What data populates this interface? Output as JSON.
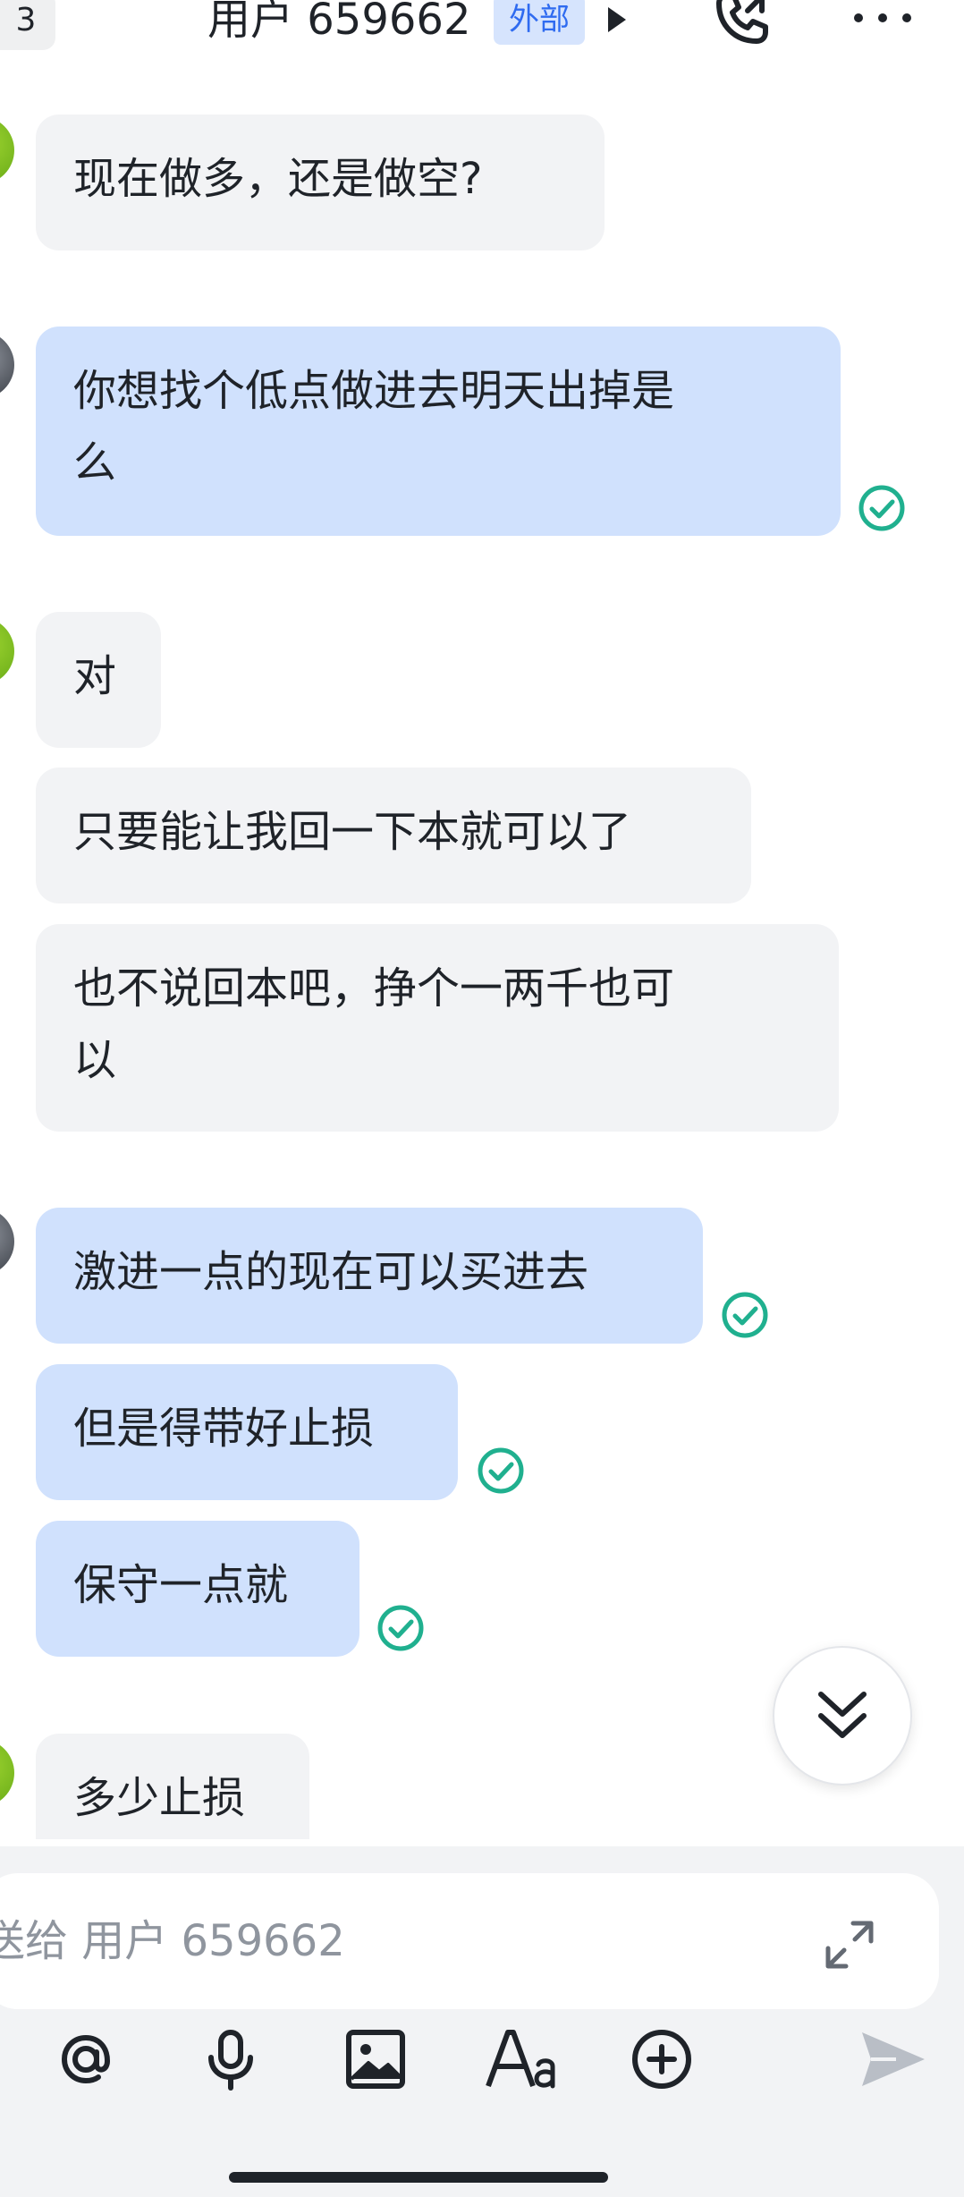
{
  "header": {
    "back_badge": "3",
    "title": "用户 659662",
    "external_tag": "外部"
  },
  "messages": [
    {
      "dir": "in",
      "text": "现在做多，还是做空?"
    },
    {
      "dir": "out",
      "text_lines": [
        "你想找个低点做进去明天出掉是",
        "么"
      ]
    },
    {
      "dir": "in",
      "text": "对"
    },
    {
      "dir": "in",
      "text": "只要能让我回一下本就可以了"
    },
    {
      "dir": "in",
      "text_lines": [
        "也不说回本吧，挣个一两千也可",
        "以"
      ]
    },
    {
      "dir": "out",
      "text": "激进一点的现在可以买进去"
    },
    {
      "dir": "out",
      "text": "但是得带好止损"
    },
    {
      "dir": "out",
      "text": "保守一点就"
    },
    {
      "dir": "in",
      "text": "多少止损"
    }
  ],
  "composer": {
    "placeholder": "送给 用户 659662"
  },
  "colors": {
    "incoming_bubble": "#f2f3f5",
    "outgoing_bubble": "#d0e1fd",
    "read_check": "#20b08f",
    "external_tag_bg": "#d6e4fd",
    "external_tag_text": "#2f6bf0"
  },
  "icons": [
    "play-caret-icon",
    "phone-icon",
    "more-icon",
    "read-check-icon",
    "chevron-double-down-icon",
    "expand-icon",
    "at-icon",
    "microphone-icon",
    "image-icon",
    "text-format-icon",
    "plus-circle-icon",
    "send-icon"
  ]
}
